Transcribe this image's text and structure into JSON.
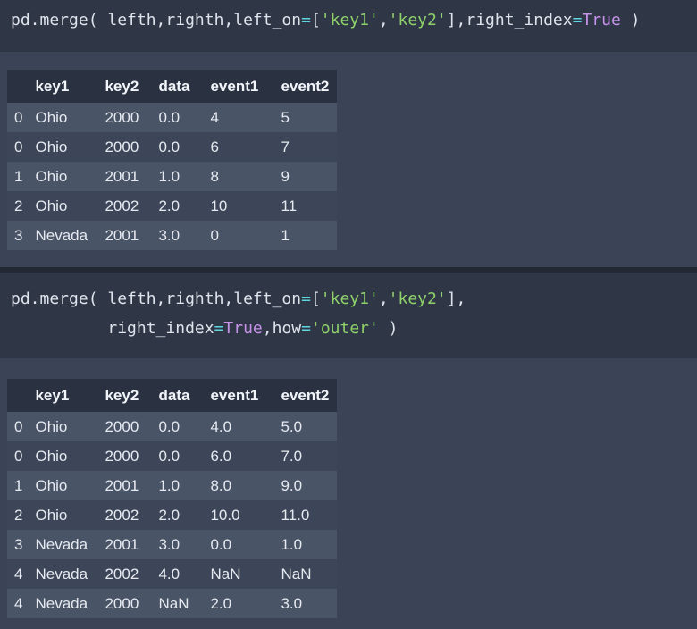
{
  "cells": [
    {
      "code_lines": [
        [
          {
            "t": "pd.merge( lefth,righth,left_on",
            "c": ""
          },
          {
            "t": "=",
            "c": "op"
          },
          {
            "t": "[",
            "c": ""
          },
          {
            "t": "'key1'",
            "c": "str"
          },
          {
            "t": ",",
            "c": ""
          },
          {
            "t": "'key2'",
            "c": "str"
          },
          {
            "t": "],right_index",
            "c": ""
          },
          {
            "t": "=",
            "c": "op"
          },
          {
            "t": "True",
            "c": "kw"
          },
          {
            "t": " )",
            "c": ""
          }
        ]
      ],
      "table": {
        "columns": [
          "",
          "key1",
          "key2",
          "data",
          "event1",
          "event2"
        ],
        "rows": [
          [
            "0",
            "Ohio",
            "2000",
            "0.0",
            "4",
            "5"
          ],
          [
            "0",
            "Ohio",
            "2000",
            "0.0",
            "6",
            "7"
          ],
          [
            "1",
            "Ohio",
            "2001",
            "1.0",
            "8",
            "9"
          ],
          [
            "2",
            "Ohio",
            "2002",
            "2.0",
            "10",
            "11"
          ],
          [
            "3",
            "Nevada",
            "2001",
            "3.0",
            "0",
            "1"
          ]
        ]
      }
    },
    {
      "code_lines": [
        [
          {
            "t": "pd.merge( lefth,righth,left_on",
            "c": ""
          },
          {
            "t": "=",
            "c": "op"
          },
          {
            "t": "[",
            "c": ""
          },
          {
            "t": "'key1'",
            "c": "str"
          },
          {
            "t": ",",
            "c": ""
          },
          {
            "t": "'key2'",
            "c": "str"
          },
          {
            "t": "],",
            "c": ""
          }
        ],
        [
          {
            "t": "          right_index",
            "c": ""
          },
          {
            "t": "=",
            "c": "op"
          },
          {
            "t": "True",
            "c": "kw"
          },
          {
            "t": ",how",
            "c": ""
          },
          {
            "t": "=",
            "c": "op"
          },
          {
            "t": "'outer'",
            "c": "str"
          },
          {
            "t": " )",
            "c": ""
          }
        ]
      ],
      "table": {
        "columns": [
          "",
          "key1",
          "key2",
          "data",
          "event1",
          "event2"
        ],
        "rows": [
          [
            "0",
            "Ohio",
            "2000",
            "0.0",
            "4.0",
            "5.0"
          ],
          [
            "0",
            "Ohio",
            "2000",
            "0.0",
            "6.0",
            "7.0"
          ],
          [
            "1",
            "Ohio",
            "2001",
            "1.0",
            "8.0",
            "9.0"
          ],
          [
            "2",
            "Ohio",
            "2002",
            "2.0",
            "10.0",
            "11.0"
          ],
          [
            "3",
            "Nevada",
            "2001",
            "3.0",
            "0.0",
            "1.0"
          ],
          [
            "4",
            "Nevada",
            "2002",
            "4.0",
            "NaN",
            "NaN"
          ],
          [
            "4",
            "Nevada",
            "2000",
            "NaN",
            "2.0",
            "3.0"
          ]
        ]
      }
    }
  ]
}
